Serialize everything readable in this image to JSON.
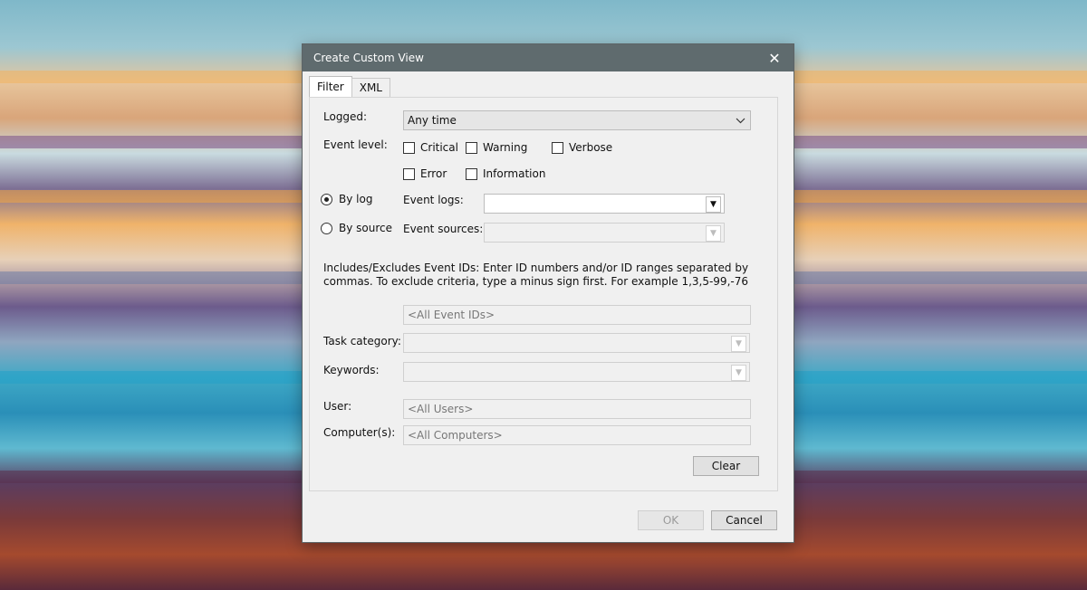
{
  "dialog": {
    "title": "Create Custom View",
    "tabs": [
      {
        "label": "Filter"
      },
      {
        "label": "XML"
      }
    ],
    "logged": {
      "label": "Logged:",
      "value": "Any time"
    },
    "event_level": {
      "label": "Event level:",
      "options": [
        {
          "label": "Critical"
        },
        {
          "label": "Warning"
        },
        {
          "label": "Verbose"
        },
        {
          "label": "Error"
        },
        {
          "label": "Information"
        }
      ]
    },
    "by_log": {
      "label": "By log"
    },
    "by_source": {
      "label": "By source"
    },
    "event_logs": {
      "label": "Event logs:",
      "value": ""
    },
    "event_sources": {
      "label": "Event sources:",
      "value": ""
    },
    "ids_description": "Includes/Excludes Event IDs: Enter ID numbers and/or ID ranges separated by commas. To exclude criteria, type a minus sign first. For example 1,3,5-99,-76",
    "event_ids_placeholder": "<All Event IDs>",
    "task_category": {
      "label": "Task category:"
    },
    "keywords": {
      "label": "Keywords:"
    },
    "user": {
      "label": "User:",
      "placeholder": "<All Users>"
    },
    "computers": {
      "label": "Computer(s):",
      "placeholder": "<All Computers>"
    },
    "clear_label": "Clear",
    "ok_label": "OK",
    "cancel_label": "Cancel",
    "close_glyph": "✕"
  }
}
